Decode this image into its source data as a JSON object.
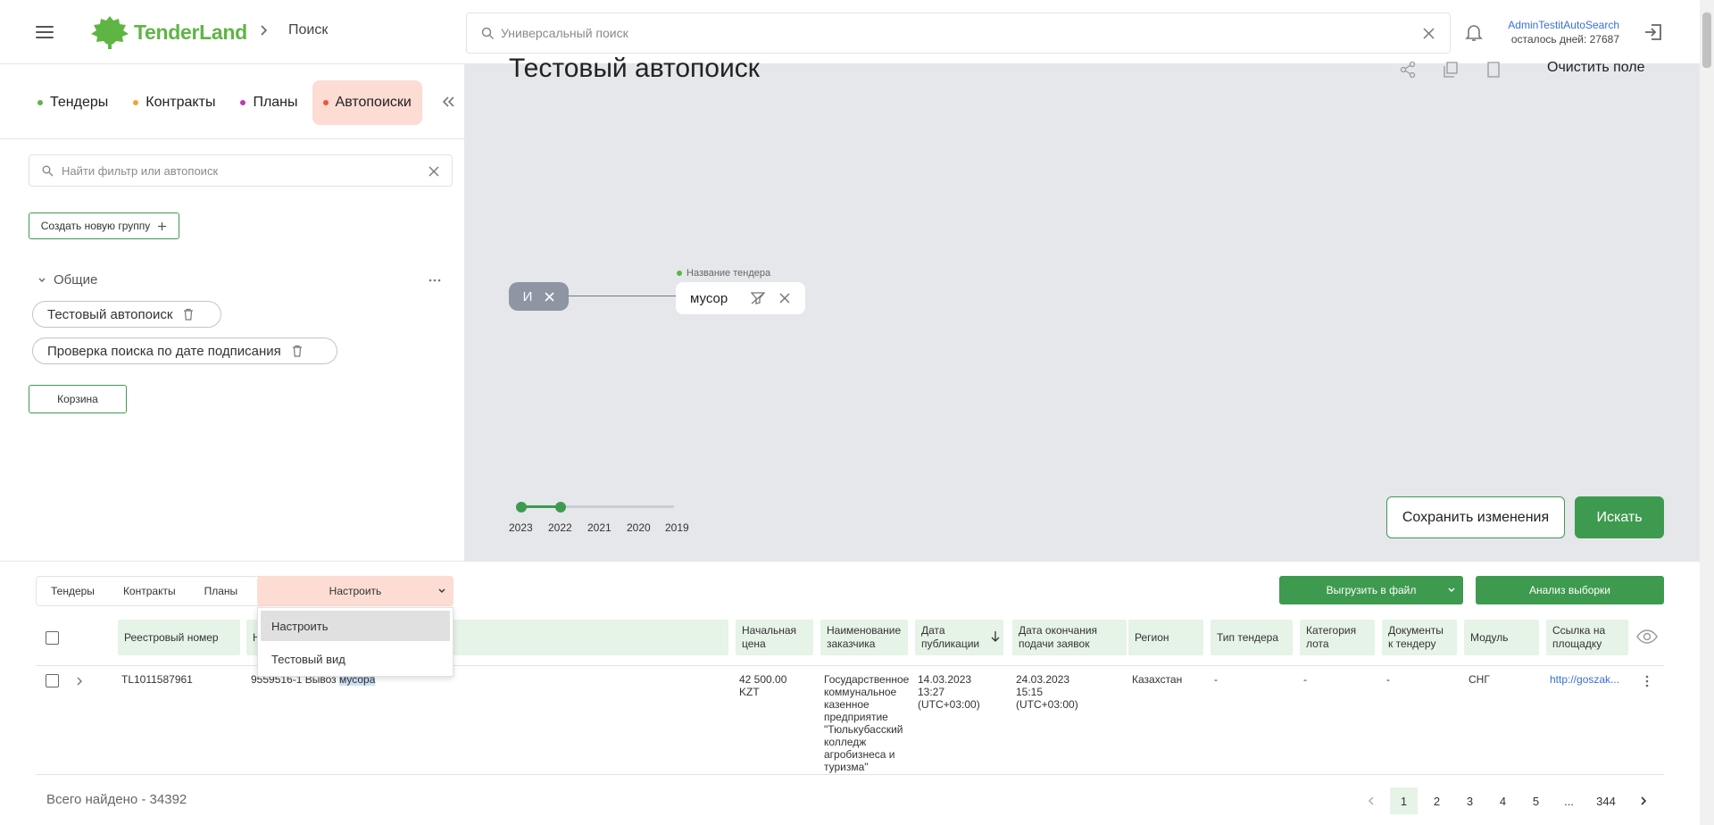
{
  "header": {
    "logo_text": "TenderLand",
    "breadcrumb": "Поиск",
    "search_placeholder": "Универсальный поиск",
    "user_name": "AdminTestitAutoSearch",
    "days_left": "осталось дней: 27687"
  },
  "sidebar": {
    "tabs": [
      {
        "label": "Тендеры",
        "dot": "#5fb544"
      },
      {
        "label": "Контракты",
        "dot": "#f0a33b"
      },
      {
        "label": "Планы",
        "dot": "#c236b5"
      },
      {
        "label": "Автопоиски",
        "dot": "#e8583a"
      }
    ],
    "filter_placeholder": "Найти фильтр или автопоиск",
    "new_group_label": "Создать новую группу",
    "group_name": "Общие",
    "autosearches": [
      "Тестовый автопоиск",
      "Проверка поиска по дате подписания"
    ],
    "trash_label": "Корзина"
  },
  "canvas": {
    "title": "Тестовый автопоиск",
    "clear_field": "Очистить поле",
    "and_node": "И",
    "field_label": "Название тендера",
    "term": "мусор",
    "years": [
      "2023",
      "2022",
      "2021",
      "2020",
      "2019"
    ],
    "save_label": "Сохранить изменения",
    "search_label": "Искать"
  },
  "results": {
    "tabs": [
      "Тендеры",
      "Контракты",
      "Планы"
    ],
    "config_label": "Настроить",
    "dropdown": [
      "Настроить",
      "Тестовый вид"
    ],
    "export_label": "Выгрузить в файл",
    "analysis_label": "Анализ выборки",
    "columns": {
      "reg": "Реестровый номер",
      "name": "Н",
      "price": "Начальная цена",
      "customer": "Наименование заказчика",
      "pubdate": "Дата публикации",
      "enddate": "Дата окончания подачи заявок",
      "region": "Регион",
      "type": "Тип тендера",
      "category": "Категория лота",
      "docs": "Документы к тендеру",
      "module": "Модуль",
      "link": "Ссылка на площадку"
    },
    "row": {
      "reg": "TL1011587961",
      "name_prefix": "9559516-1 Вывоз ",
      "name_highlight": "мусора",
      "price": "42 500.00 KZT",
      "customer": "Государственное коммунальное казенное предприятие \"Тюлькубасский колледж агробизнеса и туризма\"",
      "pubdate": "14.03.2023 13:27 (UTC+03:00)",
      "enddate": "24.03.2023 15:15 (UTC+03:00)",
      "region": "Казахстан",
      "type": "-",
      "category": "-",
      "docs": "-",
      "module": "СНГ",
      "link": "http://goszak..."
    },
    "total": "Всего найдено - 34392",
    "pages": [
      "1",
      "2",
      "3",
      "4",
      "5",
      "...",
      "344"
    ]
  },
  "colors": {
    "accent": "#3e9a4f",
    "active_tab": "#fcdcd3",
    "header_cell": "#e6f3e7"
  }
}
